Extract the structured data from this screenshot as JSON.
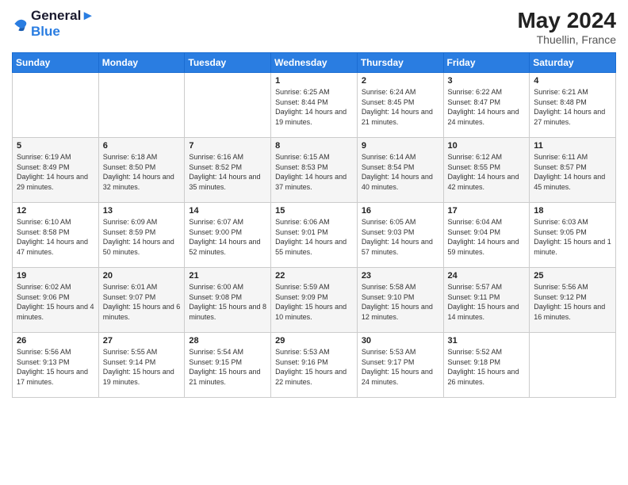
{
  "header": {
    "logo_line1": "General",
    "logo_line2": "Blue",
    "month_year": "May 2024",
    "location": "Thuellin, France"
  },
  "weekdays": [
    "Sunday",
    "Monday",
    "Tuesday",
    "Wednesday",
    "Thursday",
    "Friday",
    "Saturday"
  ],
  "weeks": [
    [
      {
        "day": "",
        "sunrise": "",
        "sunset": "",
        "daylight": ""
      },
      {
        "day": "",
        "sunrise": "",
        "sunset": "",
        "daylight": ""
      },
      {
        "day": "",
        "sunrise": "",
        "sunset": "",
        "daylight": ""
      },
      {
        "day": "1",
        "sunrise": "Sunrise: 6:25 AM",
        "sunset": "Sunset: 8:44 PM",
        "daylight": "Daylight: 14 hours and 19 minutes."
      },
      {
        "day": "2",
        "sunrise": "Sunrise: 6:24 AM",
        "sunset": "Sunset: 8:45 PM",
        "daylight": "Daylight: 14 hours and 21 minutes."
      },
      {
        "day": "3",
        "sunrise": "Sunrise: 6:22 AM",
        "sunset": "Sunset: 8:47 PM",
        "daylight": "Daylight: 14 hours and 24 minutes."
      },
      {
        "day": "4",
        "sunrise": "Sunrise: 6:21 AM",
        "sunset": "Sunset: 8:48 PM",
        "daylight": "Daylight: 14 hours and 27 minutes."
      }
    ],
    [
      {
        "day": "5",
        "sunrise": "Sunrise: 6:19 AM",
        "sunset": "Sunset: 8:49 PM",
        "daylight": "Daylight: 14 hours and 29 minutes."
      },
      {
        "day": "6",
        "sunrise": "Sunrise: 6:18 AM",
        "sunset": "Sunset: 8:50 PM",
        "daylight": "Daylight: 14 hours and 32 minutes."
      },
      {
        "day": "7",
        "sunrise": "Sunrise: 6:16 AM",
        "sunset": "Sunset: 8:52 PM",
        "daylight": "Daylight: 14 hours and 35 minutes."
      },
      {
        "day": "8",
        "sunrise": "Sunrise: 6:15 AM",
        "sunset": "Sunset: 8:53 PM",
        "daylight": "Daylight: 14 hours and 37 minutes."
      },
      {
        "day": "9",
        "sunrise": "Sunrise: 6:14 AM",
        "sunset": "Sunset: 8:54 PM",
        "daylight": "Daylight: 14 hours and 40 minutes."
      },
      {
        "day": "10",
        "sunrise": "Sunrise: 6:12 AM",
        "sunset": "Sunset: 8:55 PM",
        "daylight": "Daylight: 14 hours and 42 minutes."
      },
      {
        "day": "11",
        "sunrise": "Sunrise: 6:11 AM",
        "sunset": "Sunset: 8:57 PM",
        "daylight": "Daylight: 14 hours and 45 minutes."
      }
    ],
    [
      {
        "day": "12",
        "sunrise": "Sunrise: 6:10 AM",
        "sunset": "Sunset: 8:58 PM",
        "daylight": "Daylight: 14 hours and 47 minutes."
      },
      {
        "day": "13",
        "sunrise": "Sunrise: 6:09 AM",
        "sunset": "Sunset: 8:59 PM",
        "daylight": "Daylight: 14 hours and 50 minutes."
      },
      {
        "day": "14",
        "sunrise": "Sunrise: 6:07 AM",
        "sunset": "Sunset: 9:00 PM",
        "daylight": "Daylight: 14 hours and 52 minutes."
      },
      {
        "day": "15",
        "sunrise": "Sunrise: 6:06 AM",
        "sunset": "Sunset: 9:01 PM",
        "daylight": "Daylight: 14 hours and 55 minutes."
      },
      {
        "day": "16",
        "sunrise": "Sunrise: 6:05 AM",
        "sunset": "Sunset: 9:03 PM",
        "daylight": "Daylight: 14 hours and 57 minutes."
      },
      {
        "day": "17",
        "sunrise": "Sunrise: 6:04 AM",
        "sunset": "Sunset: 9:04 PM",
        "daylight": "Daylight: 14 hours and 59 minutes."
      },
      {
        "day": "18",
        "sunrise": "Sunrise: 6:03 AM",
        "sunset": "Sunset: 9:05 PM",
        "daylight": "Daylight: 15 hours and 1 minute."
      }
    ],
    [
      {
        "day": "19",
        "sunrise": "Sunrise: 6:02 AM",
        "sunset": "Sunset: 9:06 PM",
        "daylight": "Daylight: 15 hours and 4 minutes."
      },
      {
        "day": "20",
        "sunrise": "Sunrise: 6:01 AM",
        "sunset": "Sunset: 9:07 PM",
        "daylight": "Daylight: 15 hours and 6 minutes."
      },
      {
        "day": "21",
        "sunrise": "Sunrise: 6:00 AM",
        "sunset": "Sunset: 9:08 PM",
        "daylight": "Daylight: 15 hours and 8 minutes."
      },
      {
        "day": "22",
        "sunrise": "Sunrise: 5:59 AM",
        "sunset": "Sunset: 9:09 PM",
        "daylight": "Daylight: 15 hours and 10 minutes."
      },
      {
        "day": "23",
        "sunrise": "Sunrise: 5:58 AM",
        "sunset": "Sunset: 9:10 PM",
        "daylight": "Daylight: 15 hours and 12 minutes."
      },
      {
        "day": "24",
        "sunrise": "Sunrise: 5:57 AM",
        "sunset": "Sunset: 9:11 PM",
        "daylight": "Daylight: 15 hours and 14 minutes."
      },
      {
        "day": "25",
        "sunrise": "Sunrise: 5:56 AM",
        "sunset": "Sunset: 9:12 PM",
        "daylight": "Daylight: 15 hours and 16 minutes."
      }
    ],
    [
      {
        "day": "26",
        "sunrise": "Sunrise: 5:56 AM",
        "sunset": "Sunset: 9:13 PM",
        "daylight": "Daylight: 15 hours and 17 minutes."
      },
      {
        "day": "27",
        "sunrise": "Sunrise: 5:55 AM",
        "sunset": "Sunset: 9:14 PM",
        "daylight": "Daylight: 15 hours and 19 minutes."
      },
      {
        "day": "28",
        "sunrise": "Sunrise: 5:54 AM",
        "sunset": "Sunset: 9:15 PM",
        "daylight": "Daylight: 15 hours and 21 minutes."
      },
      {
        "day": "29",
        "sunrise": "Sunrise: 5:53 AM",
        "sunset": "Sunset: 9:16 PM",
        "daylight": "Daylight: 15 hours and 22 minutes."
      },
      {
        "day": "30",
        "sunrise": "Sunrise: 5:53 AM",
        "sunset": "Sunset: 9:17 PM",
        "daylight": "Daylight: 15 hours and 24 minutes."
      },
      {
        "day": "31",
        "sunrise": "Sunrise: 5:52 AM",
        "sunset": "Sunset: 9:18 PM",
        "daylight": "Daylight: 15 hours and 26 minutes."
      },
      {
        "day": "",
        "sunrise": "",
        "sunset": "",
        "daylight": ""
      }
    ]
  ]
}
